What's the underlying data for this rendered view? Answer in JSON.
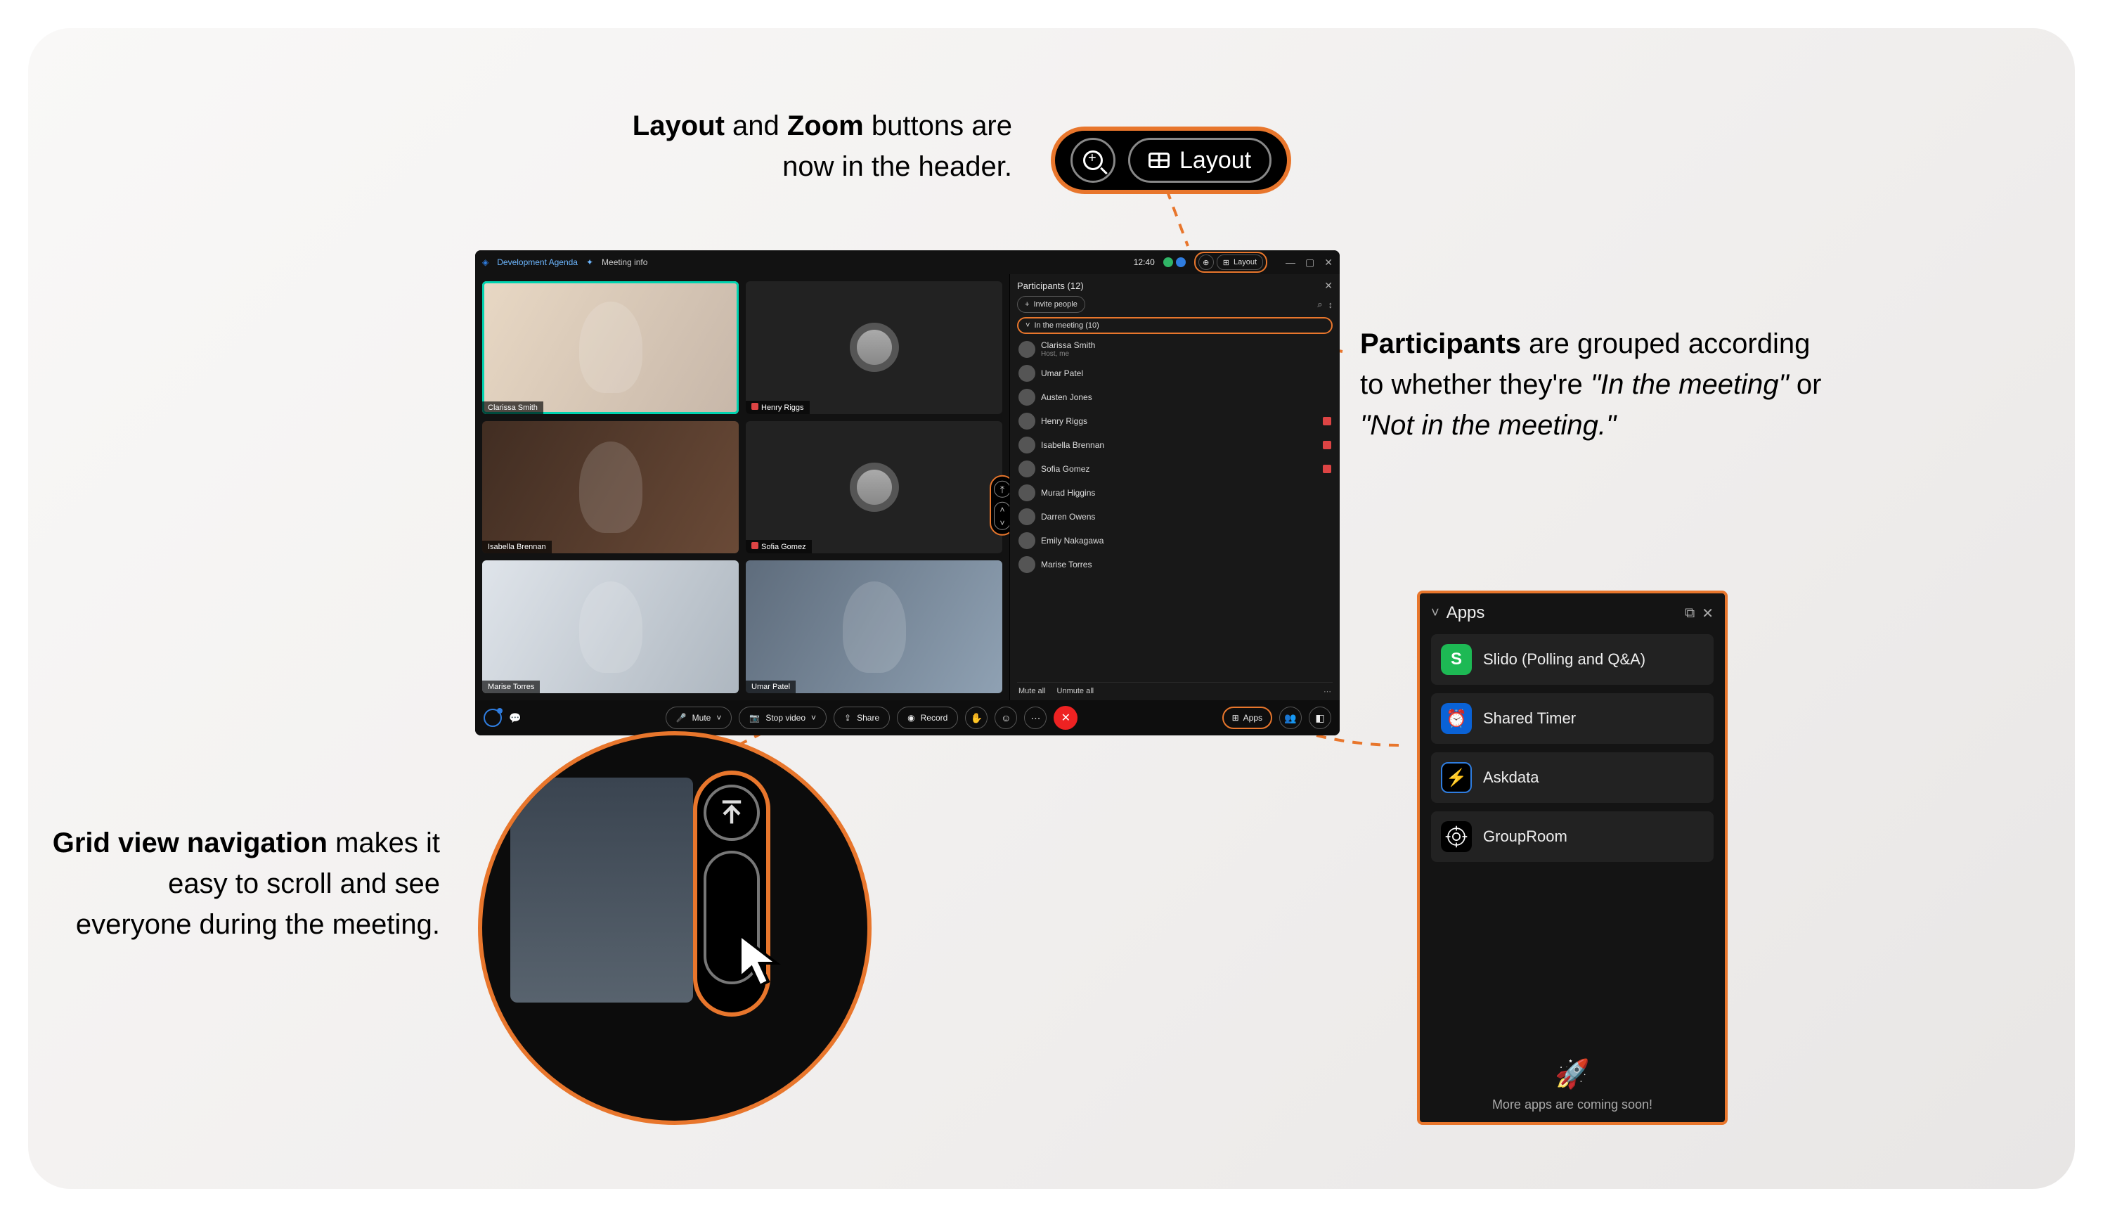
{
  "annotations": {
    "layoutZoom_part1": "Layout",
    "layoutZoom_and": " and ",
    "layoutZoom_part2": "Zoom",
    "layoutZoom_rest": " buttons are now in the header.",
    "gridNavTitle": "Grid view navigation",
    "gridNavRest": " makes it easy to scroll and see everyone during the meeting.",
    "participantsTitle": "Participants",
    "participantsRest1": " are grouped according to whether they're ",
    "participantsItalic1": "\"In the meeting\"",
    "participantsRest2": " or ",
    "participantsItalic2": "\"Not in the meeting.\""
  },
  "layoutBubble": {
    "layoutLabel": "Layout"
  },
  "meeting": {
    "title": "Development Agenda",
    "infoLabel": "Meeting info",
    "time": "12:40",
    "headerLayoutLabel": "Layout",
    "tiles": [
      {
        "name": "Clarissa Smith",
        "muted": false,
        "type": "video",
        "bg": "bg-a",
        "active": true
      },
      {
        "name": "Henry Riggs",
        "muted": true,
        "type": "avatar",
        "bg": ""
      },
      {
        "name": "Isabella Brennan",
        "muted": false,
        "type": "video",
        "bg": "bg-b"
      },
      {
        "name": "Sofia Gomez",
        "muted": true,
        "type": "avatar",
        "bg": ""
      },
      {
        "name": "Marise Torres",
        "muted": false,
        "type": "video",
        "bg": "bg-c"
      },
      {
        "name": "Umar Patel",
        "muted": false,
        "type": "video",
        "bg": "bg-d"
      }
    ],
    "footer": {
      "mute": "Mute",
      "stopVideo": "Stop video",
      "share": "Share",
      "record": "Record",
      "apps": "Apps"
    }
  },
  "participants": {
    "title": "Participants (12)",
    "invite": "Invite people",
    "groupLabel": "In the meeting (10)",
    "list": [
      {
        "name": "Clarissa Smith",
        "sub": "Host, me",
        "muted": false
      },
      {
        "name": "Umar Patel",
        "sub": "",
        "muted": false
      },
      {
        "name": "Austen Jones",
        "sub": "",
        "muted": false
      },
      {
        "name": "Henry Riggs",
        "sub": "",
        "muted": true
      },
      {
        "name": "Isabella Brennan",
        "sub": "",
        "muted": true
      },
      {
        "name": "Sofia Gomez",
        "sub": "",
        "muted": true
      },
      {
        "name": "Murad Higgins",
        "sub": "",
        "muted": false
      },
      {
        "name": "Darren Owens",
        "sub": "",
        "muted": false
      },
      {
        "name": "Emily Nakagawa",
        "sub": "",
        "muted": false
      },
      {
        "name": "Marise Torres",
        "sub": "",
        "muted": false
      }
    ],
    "muteAll": "Mute all",
    "unmuteAll": "Unmute all"
  },
  "appsPanel": {
    "title": "Apps",
    "items": [
      {
        "name": "Slido (Polling and Q&A)",
        "icon": "slido",
        "glyph": "S"
      },
      {
        "name": "Shared Timer",
        "icon": "timer",
        "glyph": "⏰"
      },
      {
        "name": "Askdata",
        "icon": "askdata",
        "glyph": "⚡"
      },
      {
        "name": "GroupRoom",
        "icon": "grouproom",
        "glyph": ""
      }
    ],
    "footer": "More apps are coming soon!"
  }
}
